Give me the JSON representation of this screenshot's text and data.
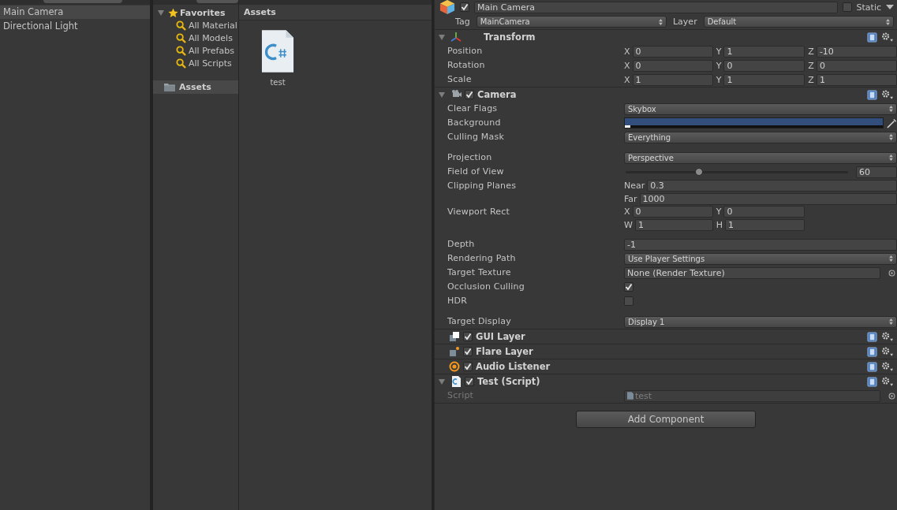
{
  "hierarchy": {
    "items": [
      {
        "label": "Main Camera",
        "selected": true
      },
      {
        "label": "Directional Light",
        "selected": false
      }
    ]
  },
  "project": {
    "favorites": {
      "label": "Favorites",
      "expanded": true,
      "children": [
        {
          "label": "All Material"
        },
        {
          "label": "All Models"
        },
        {
          "label": "All Prefabs"
        },
        {
          "label": "All Scripts"
        }
      ]
    },
    "folders": [
      {
        "label": "Assets",
        "selected": true
      }
    ],
    "breadcrumb": "Assets",
    "files": [
      {
        "name": "test",
        "kind": "csharp"
      }
    ]
  },
  "inspector": {
    "object": {
      "enabled": true,
      "name": "Main Camera",
      "static_label": "Static",
      "static": false,
      "tag_label": "Tag",
      "tag": "MainCamera",
      "layer_label": "Layer",
      "layer": "Default"
    },
    "components": [
      {
        "name": "Transform",
        "kind": "transform",
        "expanded": true,
        "props": [
          {
            "kind": "fields",
            "label": "Position",
            "rows": [
              [
                {
                  "axis": "X",
                  "value": "0"
                },
                {
                  "axis": "Y",
                  "value": "1"
                },
                {
                  "axis": "Z",
                  "value": "-10"
                }
              ]
            ]
          },
          {
            "kind": "fields",
            "label": "Rotation",
            "rows": [
              [
                {
                  "axis": "X",
                  "value": "0"
                },
                {
                  "axis": "Y",
                  "value": "0"
                },
                {
                  "axis": "Z",
                  "value": "0"
                }
              ]
            ]
          },
          {
            "kind": "fields",
            "label": "Scale",
            "rows": [
              [
                {
                  "axis": "X",
                  "value": "1"
                },
                {
                  "axis": "Y",
                  "value": "1"
                },
                {
                  "axis": "Z",
                  "value": "1"
                }
              ]
            ]
          }
        ]
      },
      {
        "name": "Camera",
        "kind": "camera",
        "expanded": true,
        "enabled": true,
        "props": [
          {
            "kind": "dropdown",
            "label": "Clear Flags",
            "value": "Skybox"
          },
          {
            "kind": "color",
            "label": "Background",
            "color": "#314e7c",
            "level": 0.02
          },
          {
            "kind": "dropdown",
            "label": "Culling Mask",
            "value": "Everything"
          },
          {
            "kind": "dropdown",
            "label": "Projection",
            "value": "Perspective",
            "gap_before": true
          },
          {
            "kind": "slider",
            "label": "Field of View",
            "level": 0.33,
            "value": "60"
          },
          {
            "kind": "fields",
            "label": "Clipping Planes",
            "rows": [
              [
                {
                  "axis": "Near",
                  "value": "0.3"
                }
              ],
              [
                {
                  "axis": "Far",
                  "value": "1000"
                }
              ]
            ]
          },
          {
            "kind": "fields",
            "label": "Viewport Rect",
            "rows": [
              [
                {
                  "axis": "X",
                  "value": "0"
                },
                {
                  "axis": "Y",
                  "value": "0"
                }
              ],
              [
                {
                  "axis": "W",
                  "value": "1"
                },
                {
                  "axis": "H",
                  "value": "1"
                }
              ]
            ]
          },
          {
            "kind": "number",
            "label": "Depth",
            "value": "-1",
            "gap_before": true
          },
          {
            "kind": "dropdown",
            "label": "Rendering Path",
            "value": "Use Player Settings"
          },
          {
            "kind": "object",
            "label": "Target Texture",
            "value": "None (Render Texture)",
            "disabled": false
          },
          {
            "kind": "checkbox",
            "label": "Occlusion Culling",
            "checked": true
          },
          {
            "kind": "checkbox",
            "label": "HDR",
            "checked": false
          },
          {
            "kind": "dropdown",
            "label": "Target Display",
            "value": "Display 1",
            "gap_before": true
          }
        ]
      },
      {
        "name": "GUI Layer",
        "kind": "gui",
        "enabled": true
      },
      {
        "name": "Flare Layer",
        "kind": "flare",
        "enabled": true
      },
      {
        "name": "Audio Listener",
        "kind": "audio",
        "enabled": true
      },
      {
        "name": "Test (Script)",
        "kind": "script",
        "expanded": true,
        "enabled": true,
        "props": [
          {
            "kind": "object",
            "label": "Script",
            "value": "test",
            "disabled": true
          }
        ]
      }
    ],
    "add_button": "Add Component"
  }
}
